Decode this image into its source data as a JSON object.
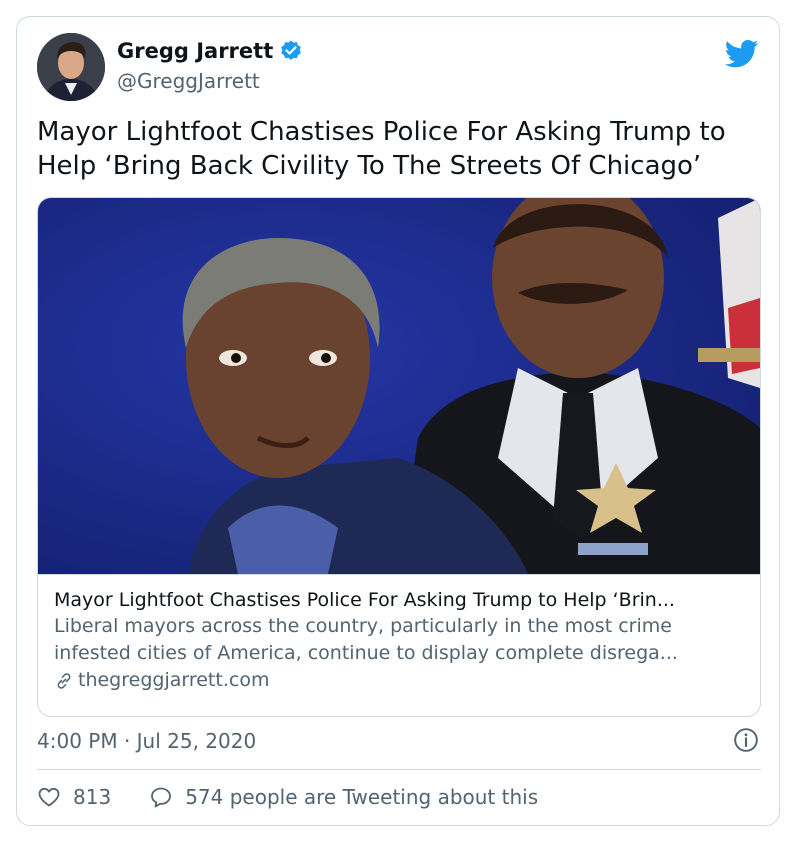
{
  "author": {
    "name": "Gregg Jarrett",
    "handle": "@GreggJarrett"
  },
  "tweet": {
    "text": "Mayor Lightfoot Chastises Police For Asking Trump to Help ‘Bring Back Civility To The Streets Of Chicago’",
    "timestamp": "4:00 PM · Jul 25, 2020"
  },
  "link_card": {
    "title": "Mayor Lightfoot Chastises Police For Asking Trump to Help ‘Brin...",
    "description": "Liberal mayors across the country, particularly in the most crime infested cities of America, continue to display complete disrega...",
    "domain": "thegreggjarrett.com"
  },
  "actions": {
    "likes": "813",
    "tweeting": "574 people are Tweeting about this"
  },
  "colors": {
    "accent": "#1d9bf0",
    "text_primary": "#0f1419",
    "text_secondary": "#536471",
    "border": "#cfd9de",
    "photo_background": "#1b2a8c"
  },
  "icons": {
    "verified": "verified-badge-icon",
    "brand": "twitter-bird-icon",
    "link": "link-icon",
    "info": "info-icon",
    "like": "heart-icon",
    "reply": "speech-bubble-icon"
  }
}
